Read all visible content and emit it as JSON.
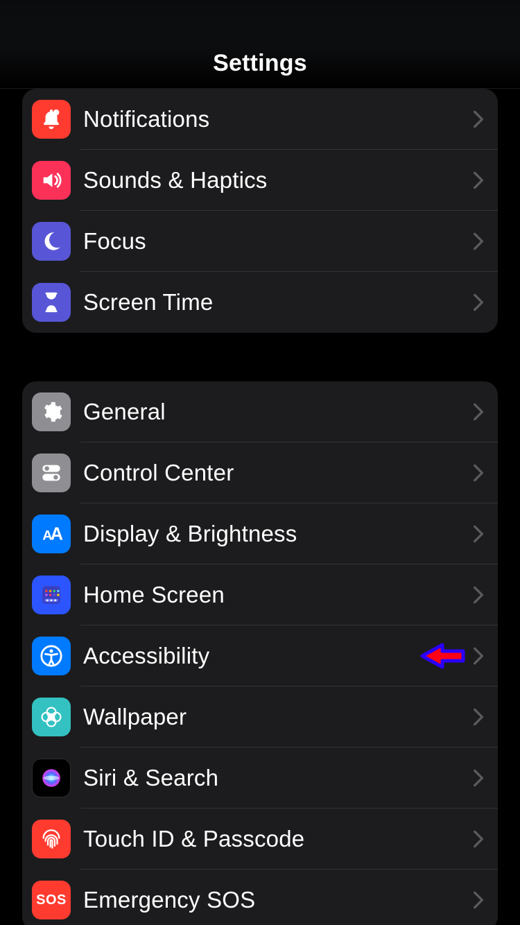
{
  "header": {
    "title": "Settings"
  },
  "groups": [
    {
      "rows": [
        {
          "label": "Notifications"
        },
        {
          "label": "Sounds & Haptics"
        },
        {
          "label": "Focus"
        },
        {
          "label": "Screen Time"
        }
      ]
    },
    {
      "rows": [
        {
          "label": "General"
        },
        {
          "label": "Control Center"
        },
        {
          "label": "Display & Brightness"
        },
        {
          "label": "Home Screen"
        },
        {
          "label": "Accessibility"
        },
        {
          "label": "Wallpaper"
        },
        {
          "label": "Siri & Search"
        },
        {
          "label": "Touch ID & Passcode"
        },
        {
          "label": "Emergency SOS"
        }
      ]
    }
  ],
  "annotation": {
    "target_row": "Accessibility",
    "style": "red-arrow-with-blue-outline",
    "direction": "left"
  },
  "sos_text": "SOS"
}
